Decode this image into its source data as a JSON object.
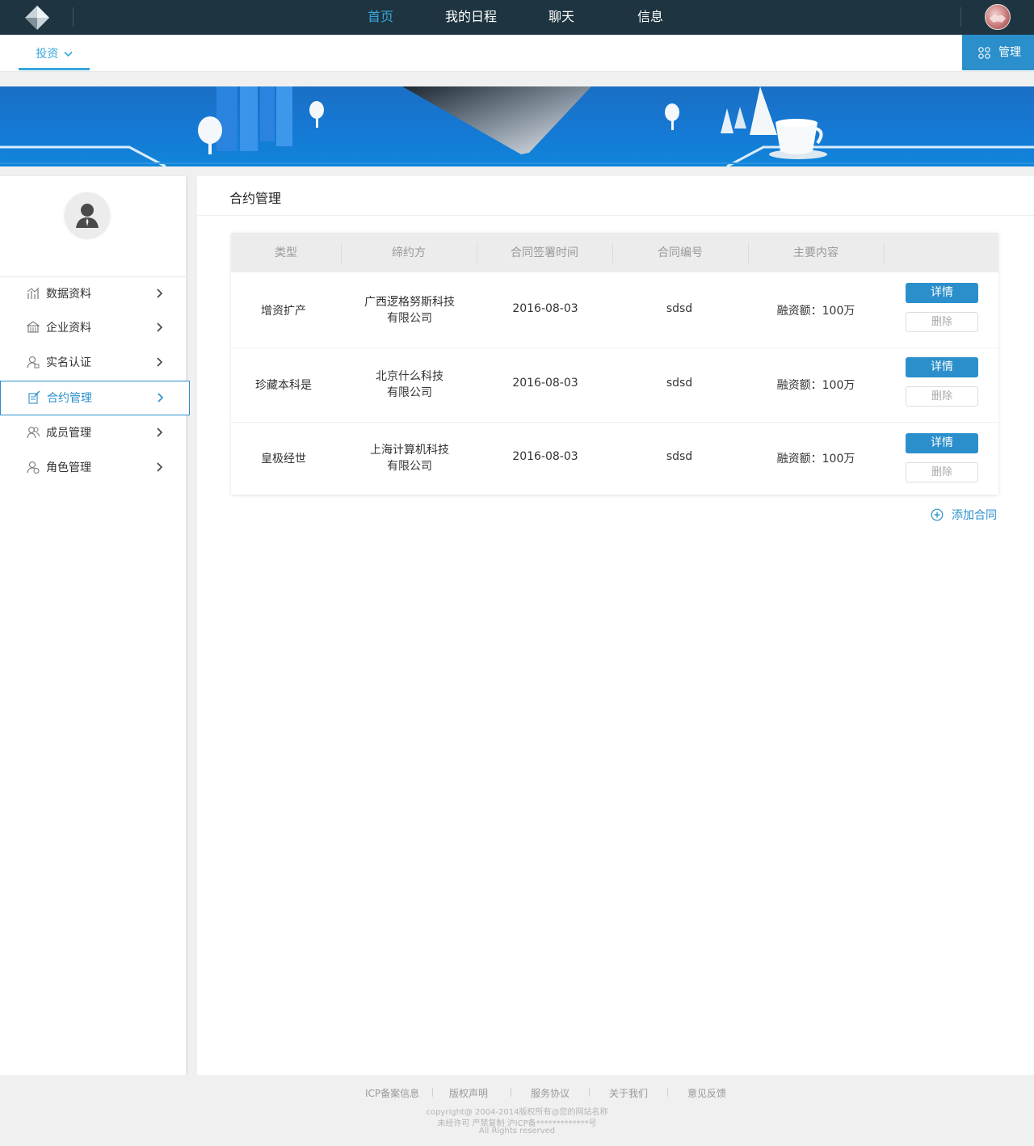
{
  "topbar": {
    "nav": [
      "首页",
      "我的日程",
      "聊天",
      "信息"
    ],
    "active_index": 0
  },
  "subbar": {
    "invest_tab": "投资",
    "manage_button": "管理"
  },
  "sidebar": {
    "items": [
      {
        "label": "数据资料",
        "icon": "chart-icon"
      },
      {
        "label": "企业资料",
        "icon": "building-icon"
      },
      {
        "label": "实名认证",
        "icon": "user-verify-icon"
      },
      {
        "label": "合约管理",
        "icon": "contract-icon"
      },
      {
        "label": "成员管理",
        "icon": "members-icon"
      },
      {
        "label": "角色管理",
        "icon": "role-icon"
      }
    ],
    "active_index": 3
  },
  "content": {
    "title": "合约管理",
    "table": {
      "headers": [
        "类型",
        "缔约方",
        "合同签署时间",
        "合同编号",
        "主要内容"
      ],
      "rows": [
        {
          "type": "增资扩产",
          "party_line1": "广西逻格努斯科技",
          "party_line2": "有限公司",
          "date": "2016-08-03",
          "number": "sdsd",
          "content": "融资额：100万"
        },
        {
          "type": "珍藏本科是",
          "party_line1": "北京什么科技",
          "party_line2": "有限公司",
          "date": "2016-08-03",
          "number": "sdsd",
          "content": "融资额：100万"
        },
        {
          "type": "皇极经世",
          "party_line1": "上海计算机科技",
          "party_line2": "有限公司",
          "date": "2016-08-03",
          "number": "sdsd",
          "content": "融资额：100万"
        }
      ],
      "detail_label": "详情",
      "delete_label": "删除"
    },
    "add_contract": "添加合同"
  },
  "footer": {
    "links": [
      "ICP备案信息",
      "版权声明",
      "服务协议",
      "关于我们",
      "意见反馈"
    ],
    "copyright": "copyright@ 2004-2014版权所有@您的网站名称",
    "license": "未经许可 严禁复制 沪ICP备*************号",
    "rights": "All Rights reserved"
  },
  "colors": {
    "topbar": "#1e3440",
    "accent": "#2b8fcb",
    "nav_active": "#39a6dc"
  }
}
